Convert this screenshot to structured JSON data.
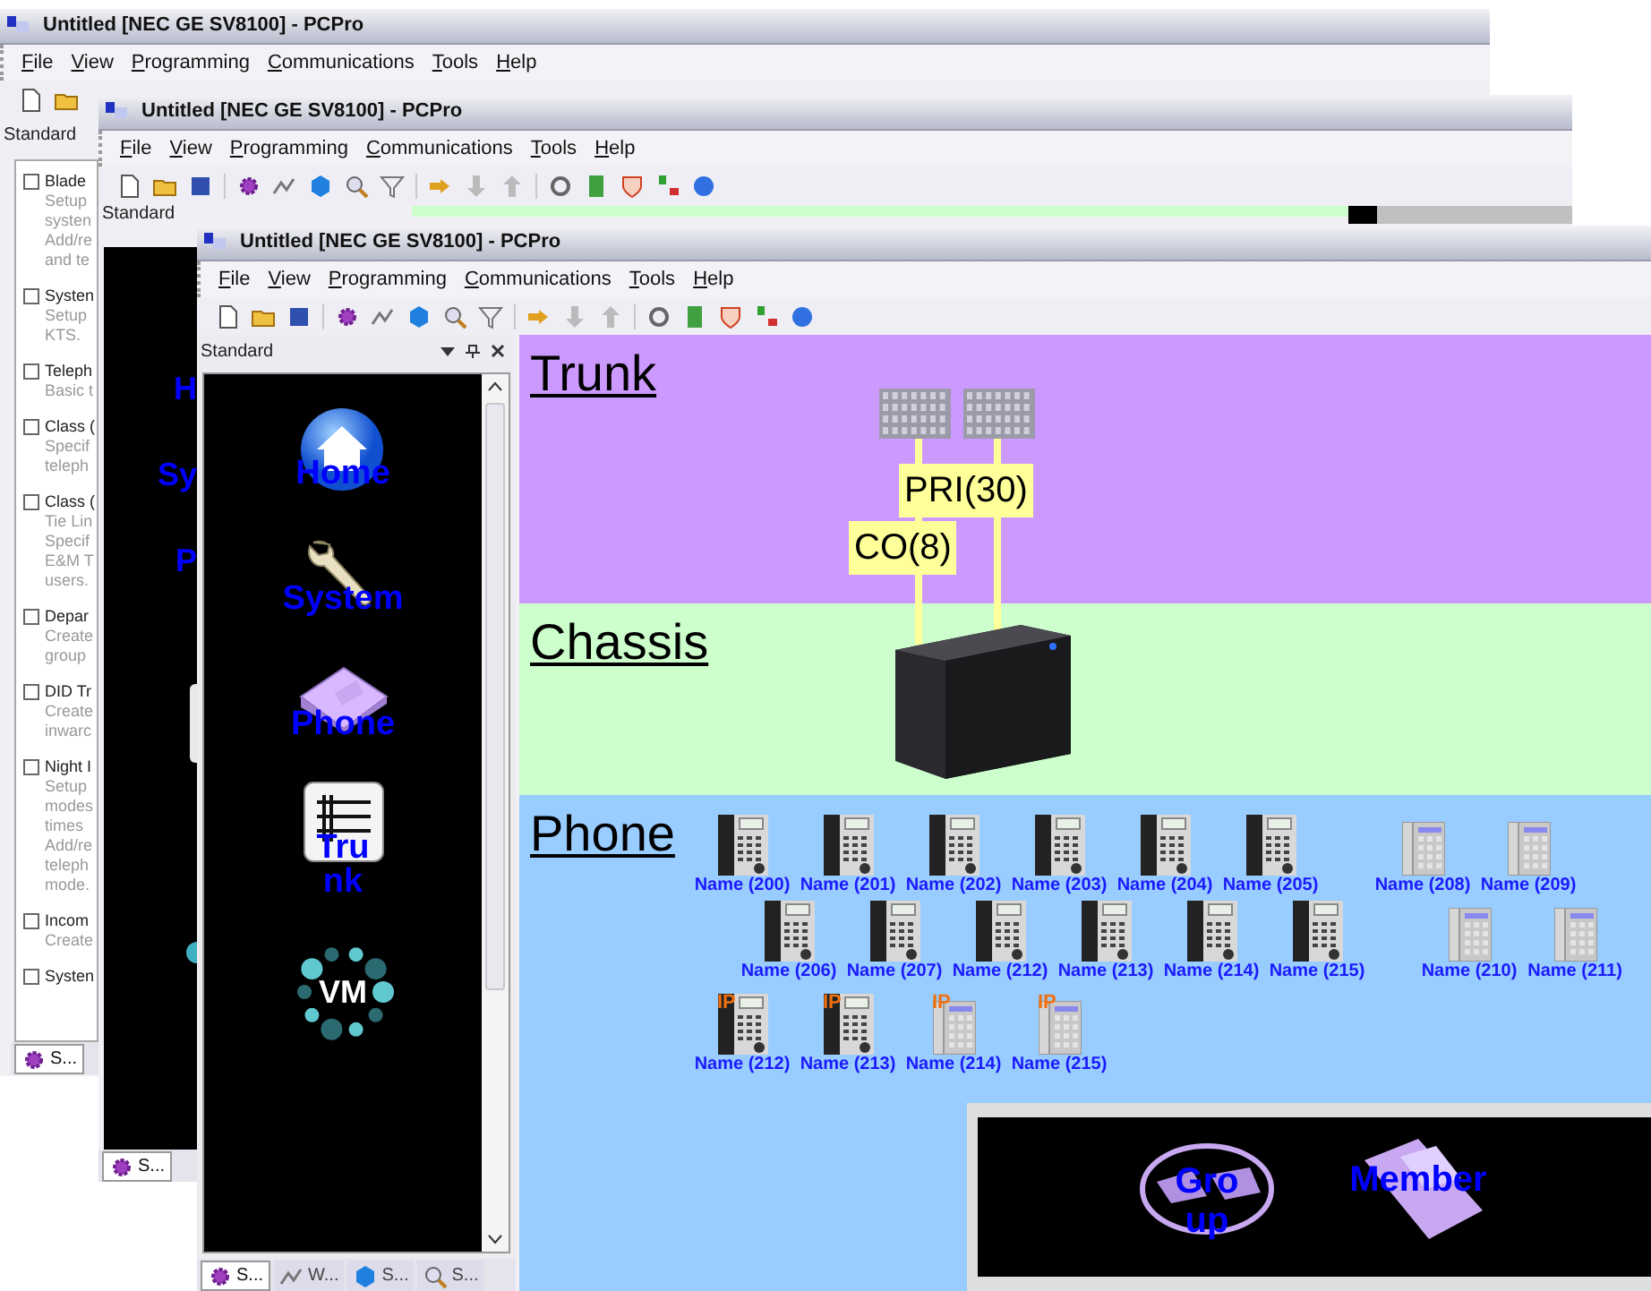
{
  "back_window": {
    "title": "Untitled [NEC GE SV8100] - PCPro",
    "menu": [
      "File",
      "View",
      "Programming",
      "Communications",
      "Tools",
      "Help"
    ],
    "panel_title": "Standard",
    "tasks": [
      {
        "title": "Blade",
        "checked": false,
        "lines": [
          "Setup",
          "systen",
          "Add/re",
          "and te"
        ]
      },
      {
        "title": "Systen",
        "checked": false,
        "lines": [
          "Setup",
          "KTS."
        ]
      },
      {
        "title": "Teleph",
        "checked": false,
        "lines": [
          "Basic t"
        ]
      },
      {
        "title": "Class (",
        "checked": false,
        "lines": [
          "Specif",
          "teleph"
        ]
      },
      {
        "title": "Class (",
        "checked": false,
        "lines": [
          "Tie Lin",
          "Specif",
          "E&M T",
          "users."
        ]
      },
      {
        "title": "Depar",
        "checked": false,
        "lines": [
          "Create",
          "group"
        ]
      },
      {
        "title": "DID Tr",
        "checked": false,
        "lines": [
          "Create",
          "inwarc"
        ]
      },
      {
        "title": "Night I",
        "checked": false,
        "lines": [
          "Setup",
          "modes",
          "times",
          "Add/re",
          "teleph",
          "mode."
        ]
      },
      {
        "title": "Incom",
        "checked": false,
        "lines": [
          "Create"
        ]
      },
      {
        "title": "Systen",
        "checked": false
      }
    ],
    "tabs": [
      {
        "label": "S...",
        "selected": true
      }
    ]
  },
  "middle_window": {
    "title": "Untitled [NEC GE SV8100] - PCPro",
    "menu": [
      "File",
      "View",
      "Programming",
      "Communications",
      "Tools",
      "Help"
    ],
    "panel_title": "Standard",
    "nav_items": [
      {
        "label": "H"
      },
      {
        "label": "Sy"
      },
      {
        "label": "P"
      }
    ],
    "tabs": [
      {
        "label": "S...",
        "selected": true
      }
    ]
  },
  "front_window": {
    "title": "Untitled [NEC GE SV8100] - PCPro",
    "menu": [
      "File",
      "View",
      "Programming",
      "Communications",
      "Tools",
      "Help"
    ],
    "panel_title": "Standard",
    "nav_items": [
      {
        "kind": "home",
        "label": "Home"
      },
      {
        "kind": "system",
        "label": "System"
      },
      {
        "kind": "phone",
        "label": "Phone"
      },
      {
        "kind": "trunk",
        "label": "Trunk"
      },
      {
        "kind": "vm",
        "label": "VM"
      }
    ],
    "tabs": [
      {
        "label": "S...",
        "selected": true
      },
      {
        "label": "W...",
        "selected": false
      },
      {
        "label": "S...",
        "selected": false
      },
      {
        "label": "S...",
        "selected": false
      }
    ],
    "canvas": {
      "sections": [
        {
          "kind": "trunk",
          "label": "Trunk",
          "color": "#cc99ff"
        },
        {
          "kind": "chassis",
          "label": "Chassis",
          "color": "#ccffcc"
        },
        {
          "kind": "phone",
          "label": "Phone",
          "color": "#99ccff"
        }
      ],
      "trunk_lines": [
        {
          "label": "PRI(30)"
        },
        {
          "label": "CO(8)"
        }
      ],
      "phone_rows": [
        {
          "groups": [
            [
              {
                "name": "Name (200)",
                "kind": "digital"
              },
              {
                "name": "Name (201)",
                "kind": "digital"
              },
              {
                "name": "Name (202)",
                "kind": "digital"
              },
              {
                "name": "Name (203)",
                "kind": "digital"
              },
              {
                "name": "Name (204)",
                "kind": "digital"
              },
              {
                "name": "Name (205)",
                "kind": "digital"
              }
            ],
            [
              {
                "name": "Name (208)",
                "kind": "single"
              },
              {
                "name": "Name (209)",
                "kind": "single"
              }
            ]
          ]
        },
        {
          "groups": [
            [
              {
                "name": "Name (206)",
                "kind": "digital"
              },
              {
                "name": "Name (207)",
                "kind": "digital"
              },
              {
                "name": "Name (212)",
                "kind": "digital"
              },
              {
                "name": "Name (213)",
                "kind": "digital"
              },
              {
                "name": "Name (214)",
                "kind": "digital"
              },
              {
                "name": "Name (215)",
                "kind": "digital"
              }
            ],
            [
              {
                "name": "Name (210)",
                "kind": "single"
              },
              {
                "name": "Name (211)",
                "kind": "single"
              }
            ]
          ]
        },
        {
          "groups": [
            [
              {
                "name": "Name (212)",
                "kind": "digital",
                "badge": "IP"
              },
              {
                "name": "Name (213)",
                "kind": "digital",
                "badge": "IP"
              },
              {
                "name": "Name (214)",
                "kind": "single",
                "badge": "IP"
              },
              {
                "name": "Name (215)",
                "kind": "single",
                "badge": "IP"
              }
            ]
          ]
        }
      ],
      "popup_items": [
        {
          "kind": "group",
          "label": "Group"
        },
        {
          "kind": "member",
          "label": "Member"
        }
      ]
    }
  }
}
